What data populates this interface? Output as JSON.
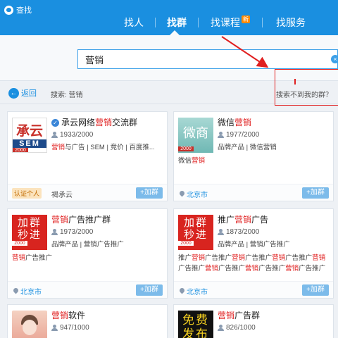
{
  "window": {
    "title": "查找"
  },
  "tabs": [
    {
      "label": "找人"
    },
    {
      "label": "找群"
    },
    {
      "label": "找课程",
      "badge": "新"
    },
    {
      "label": "找服务"
    }
  ],
  "search": {
    "value": "营销",
    "clear": "×"
  },
  "subbar": {
    "back_icon": "←",
    "back": "返回",
    "crumb": "搜索: 营销",
    "not_found": "搜索不到我的群？"
  },
  "colors": {
    "accent": "#1a8fe0",
    "highlight": "#e02020"
  },
  "cards": [
    {
      "name_pre": "承云网络",
      "name_hl": "营销",
      "name_post": "交流群",
      "verified_icon": "✓",
      "members": "1933/2000",
      "tags_hl": "营销",
      "tags": "与广告 | SEM | 竞价 | 百度推...",
      "avatar_main": "承云",
      "avatar_sub": "SEM",
      "avatar_num": "2000",
      "verify_badge": "认证个人",
      "verify_org": "褐承云",
      "join": "+加群"
    },
    {
      "name_pre": "微信",
      "name_hl": "营销",
      "name_post": "",
      "members": "1977/2000",
      "tags": "品牌产品 | 微信营销",
      "desc_pre": "微信",
      "desc_hl": "营销",
      "avatar_main": "微商",
      "avatar_num": "2000",
      "location": "北京市",
      "join": "+加群"
    },
    {
      "name_pre": "",
      "name_hl": "营销",
      "name_post": "广告推广群",
      "members": "1973/2000",
      "tags": "品牌产品 | 营销广告推广",
      "desc_hl": "营销",
      "desc_post": "广告推广",
      "avatar_l1": "加群",
      "avatar_l2": "秒进",
      "avatar_num": "2000",
      "location": "北京市",
      "join": "+加群"
    },
    {
      "name_pre": "推广",
      "name_hl": "营销",
      "name_post": "广告",
      "members": "1873/2000",
      "tags": "品牌产品 | 营销广告推广",
      "desc_line1": [
        "推广",
        "营销",
        "广告推广",
        "营销",
        "广告推广",
        "营销",
        "广告推广",
        "营销"
      ],
      "desc_line2": [
        "广告推广",
        "营销",
        "广告推广",
        "营销",
        "广告推广",
        "营销",
        "广告推广"
      ],
      "avatar_l1": "加群",
      "avatar_l2": "秒进",
      "avatar_num": "2000",
      "location": "北京市",
      "join": "+加群"
    },
    {
      "name_pre": "",
      "name_hl": "营销",
      "name_post": "软件",
      "members": "947/1000"
    },
    {
      "name_pre": "",
      "name_hl": "营销",
      "name_post": "广告群",
      "members": "826/1000",
      "avatar_l1": "免费",
      "avatar_l2": "发布"
    }
  ]
}
